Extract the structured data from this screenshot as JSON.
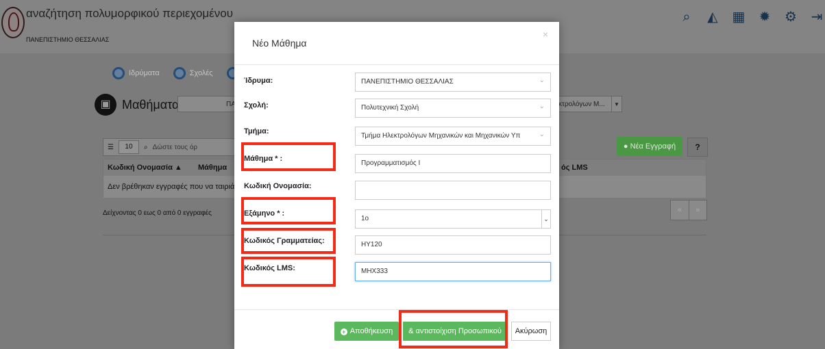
{
  "app": {
    "title": "αναζήτηση πολυμορφικού περιεχομένου",
    "subtitle": "ΠΑΝΕΠΙΣΤΗΜΙΟ ΘΕΣΣΑΛΙΑΣ",
    "top_icons": [
      "search-icon",
      "chart-icon",
      "calendar-icon",
      "bug-icon",
      "gear-icon",
      "logout-icon"
    ]
  },
  "breadcrumbs": [
    "Ιδρύματα",
    "Σχολές"
  ],
  "section": {
    "title": "Μαθήματα",
    "institution_filter": "ΠΑΝΕ",
    "department_filter": "κτρολόγων Μ..."
  },
  "table_controls": {
    "page_size": "10",
    "search_placeholder": "Δώστε τους όρ",
    "new_button": "Νέα Εγγραφή",
    "help_button": "?"
  },
  "table": {
    "columns": [
      "Κωδική Ονομασία",
      "Μάθημα",
      "ός LMS"
    ],
    "empty_message": "Δεν βρέθηκαν εγγραφές που να ταιριάζο",
    "showing": "Δείχνοντας 0 εως 0 από 0 εγγραφές",
    "pager": [
      "«",
      "»"
    ]
  },
  "modal": {
    "title": "Νέο Μάθημα",
    "close": "×",
    "fields": [
      {
        "label": "Ίδρυμα:",
        "value": "ΠΑΝΕΠΙΣΤΗΜΙΟ ΘΕΣΣΑΛΙΑΣ"
      },
      {
        "label": "Σχολή:",
        "value": "Πολυτεχνική Σχολή"
      },
      {
        "label": "Τμήμα:",
        "value": "Τμήμα Ηλεκτρολόγων Μηχανικών και Μηχανικών Υπ"
      },
      {
        "label": "Μάθημα * :",
        "value": "Προγραμματισμός Ι"
      },
      {
        "label": "Κωδική Ονομασία:",
        "value": ""
      },
      {
        "label": "Εξάμηνο * :",
        "value": "1ο"
      },
      {
        "label": "Κωδικός Γραμματείας:",
        "value": "HY120"
      },
      {
        "label": "Κωδικός LMS:",
        "value": "MHX333"
      }
    ],
    "buttons": {
      "save": "Αποθήκευση",
      "map_staff": "& αντιστοίχιση Προσωπικού",
      "cancel": "Ακύρωση"
    }
  },
  "colors": {
    "highlight": "#f52a16",
    "success": "#5cb85c"
  }
}
